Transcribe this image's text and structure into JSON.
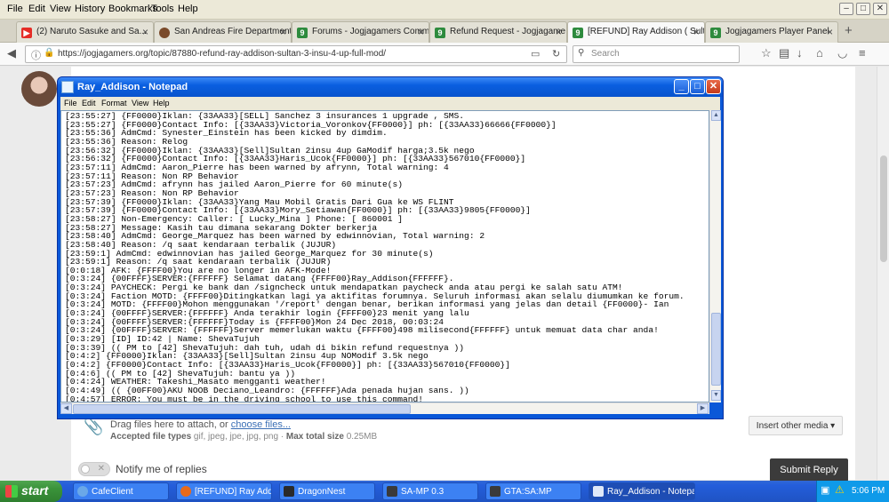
{
  "browser": {
    "menu": [
      "File",
      "Edit",
      "View",
      "History",
      "Bookmarks",
      "Tools",
      "Help"
    ],
    "tabs": [
      {
        "label": "(2) Naruto Sasuke and Sa...",
        "icon": "youtube-icon",
        "color": "#e52d27"
      },
      {
        "label": "San Andreas Fire Department...",
        "icon": "samp-icon",
        "color": "#7a4a2a"
      },
      {
        "label": "Forums - Jogjagamers Comm...",
        "icon": "jg-icon",
        "color": "#2e8b3e"
      },
      {
        "label": "Refund Request - Jogjagame...",
        "icon": "jg-icon",
        "color": "#2e8b3e"
      },
      {
        "label": "[REFUND] Ray Addison ( Sult...",
        "icon": "jg-icon",
        "color": "#2e8b3e",
        "active": true
      },
      {
        "label": "Jogjagamers Player Panel",
        "icon": "jg-icon",
        "color": "#2e8b3e"
      }
    ],
    "url": "https://jogjagamers.org/topic/87880-refund-ray-addison-sultan-3-insu-4-up-full-mod/",
    "search_placeholder": "Search"
  },
  "page": {
    "drag_text": "Drag files here to attach, or ",
    "choose_files": "choose files...",
    "accepted_label": "Accepted file types",
    "accepted_types": " gif, jpeg, jpe, jpg, png · ",
    "max_size_label": "Max total size",
    "max_size": " 0.25MB",
    "insert_media": "Insert other media ▾",
    "notify_label": "Notify me of replies",
    "submit": "Submit Reply"
  },
  "notepad": {
    "title": "Ray_Addison - Notepad",
    "menu": [
      "File",
      "Edit",
      "Format",
      "View",
      "Help"
    ],
    "lines": [
      "[23:55:27] {FF0000}Iklan: {33AA33}[SELL] Sanchez 3 insurances 1 upgrade , SMS.",
      "[23:55:27] {FF0000}Contact Info: [{33AA33}Victoria_Voronkov{FF0000}] ph: [{33AA33}66666{FF0000}]",
      "[23:55:36] AdmCmd: Synester_Einstein has been kicked by dimdim.",
      "[23:55:36] Reason: Relog",
      "[23:56:32] {FF0000}Iklan: {33AA33}[Sell]Sultan 2insu 4up GaModif harga;3.5k nego",
      "[23:56:32] {FF0000}Contact Info: [{33AA33}Haris_Ucok{FF0000}] ph: [{33AA33}567010{FF0000}]",
      "[23:57:11] AdmCmd: Aaron_Pierre has been warned by afrynn, Total warning: 4",
      "[23:57:11] Reason: Non RP Behavior",
      "[23:57:23] AdmCmd: afrynn has jailed Aaron_Pierre for 60 minute(s)",
      "[23:57:23] Reason: Non RP Behavior",
      "[23:57:39] {FF0000}Iklan: {33AA33}Yang Mau Mobil Gratis Dari Gua ke WS FLINT",
      "[23:57:39] {FF0000}Contact Info: [{33AA33}Mory_Setiawan{FF0000}] ph: [{33AA33}9805{FF0000}]",
      "[23:58:27] Non-Emergency: Caller: [ Lucky_Mina ] Phone: [ 860001 ]",
      "[23:58:27] Message: Kasih tau dimana sekarang Dokter berkerja",
      "[23:58:40] AdmCmd: George_Marquez has been warned by edwinnovian, Total warning: 2",
      "[23:58:40] Reason: /q saat kendaraan terbalik (JUJUR)",
      "[23:59:1] AdmCmd: edwinnovian has jailed George_Marquez for 30 minute(s)",
      "[23:59:1] Reason: /q saat kendaraan terbalik (JUJUR)",
      "[0:0:18] AFK: {FFFF00}You are no longer in AFK-Mode!",
      "[0:3:24] {00FFFF}SERVER:{FFFFFF} Selamat datang {FFFF00}Ray_Addison{FFFFFF}.",
      "[0:3:24] PAYCHECK: Pergi ke bank dan /signcheck untuk mendapatkan paycheck anda atau pergi ke salah satu ATM!",
      "[0:3:24] Faction MOTD: {FFFF00}Ditingkatkan lagi ya aktifitas forumnya. Seluruh informasi akan selalu diumumkan ke forum.",
      "[0:3:24] MOTD: {FFFF00}Mohon menggunakan '/report' dengan benar, berikan informasi yang jelas dan detail {FF0000}- Ian",
      "[0:3:24] {00FFFF}SERVER:{FFFFFF} Anda terakhir login {FFFF00}23 menit yang lalu",
      "[0:3:24] {00FFFF}SERVER:{FFFFFF}Today is {FFFF00}Mon 24 Dec 2018, 00:03:24",
      "[0:3:24] {00FFFF}SERVER: {FFFFFF}Server memerlukan waktu {FFFF00}498 milisecond{FFFFFF} untuk memuat data char anda!",
      "[0:3:29] [ID] ID:42 | Name: ShevaTujuh",
      "[0:3:39] (( PM to [42] ShevaTujuh: dah tuh, udah di bikin refund requestnya ))",
      "[0:4:2] {FF0000}Iklan: {33AA33}[Sell]Sultan 2insu 4up NOModif 3.5k nego",
      "[0:4:2] {FF0000}Contact Info: [{33AA33}Haris_Ucok{FF0000}] ph: [{33AA33}567010{FF0000}]",
      "[0:4:6] (( PM to [42] ShevaTujuh: bantu ya ))",
      "[0:4:24] WEATHER: Takeshi_Masato mengganti weather!",
      "[0:4:49] (( {00FF00}AKU NOOB Deciano_Leandro: {FFFFFF}Ada penada hujan sans. ))",
      "[0:4:57] ERROR: You must be in the driving school to use this command!"
    ]
  },
  "taskbar": {
    "start": "start",
    "tasks": [
      {
        "label": "CafeClient",
        "color": "#6aa8e8"
      },
      {
        "label": "[REFUND] Ray Addis...",
        "color": "#e86a1a"
      },
      {
        "label": "DragonNest",
        "color": "#2a2a2a"
      },
      {
        "label": "SA-MP 0.3",
        "color": "#3a3a3a"
      },
      {
        "label": "GTA:SA:MP",
        "color": "#3a3a3a"
      },
      {
        "label": "Ray_Addison - Notepad",
        "color": "#dfe8f8",
        "active": true
      }
    ],
    "clock": "5:06 PM"
  }
}
